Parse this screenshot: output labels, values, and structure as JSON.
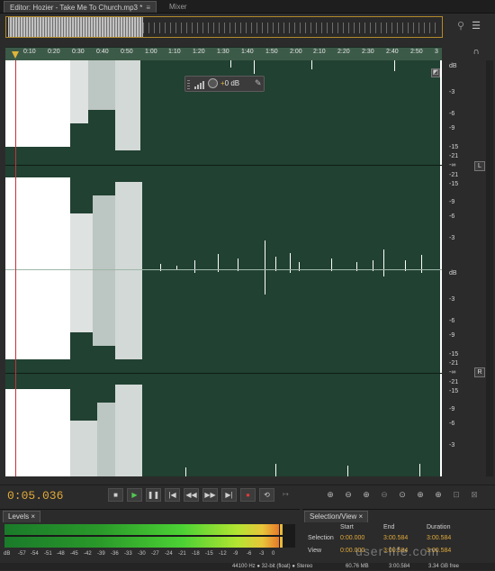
{
  "tabs": {
    "editor": "Editor: Hozier - Take Me To Church.mp3 *",
    "editor_close": "≡",
    "mixer": "Mixer"
  },
  "ruler": {
    "ticks": [
      "0:10",
      "0:20",
      "0:30",
      "0:40",
      "0:50",
      "1:00",
      "1:10",
      "1:20",
      "1:30",
      "1:40",
      "1:50",
      "2:00",
      "2:10",
      "2:20",
      "2:30",
      "2:40",
      "2:50",
      "3"
    ]
  },
  "hud": {
    "volume_prefix": "+",
    "volume_value": "0 dB"
  },
  "db_scale": {
    "top": [
      "dB",
      "-3",
      "-6",
      "-9",
      "-15",
      "-21",
      "-∞",
      "-21",
      "-15",
      "-9",
      "-6",
      "-3"
    ],
    "bottom": [
      "dB",
      "-3",
      "-6",
      "-9",
      "-15",
      "-21",
      "-∞",
      "-21",
      "-15",
      "-9",
      "-6",
      "-3"
    ],
    "left_label": "L",
    "right_label": "R"
  },
  "transport": {
    "timecode": "0:05.036"
  },
  "levels": {
    "tab_label": "Levels",
    "scale": [
      "dB",
      "-57",
      "-54",
      "-51",
      "-48",
      "-45",
      "-42",
      "-39",
      "-36",
      "-33",
      "-30",
      "-27",
      "-24",
      "-21",
      "-18",
      "-15",
      "-12",
      "-9",
      "-6",
      "-3",
      "0"
    ]
  },
  "selection_view": {
    "tab_label": "Selection/View",
    "headers": {
      "start": "Start",
      "end": "End",
      "duration": "Duration"
    },
    "rows": [
      {
        "label": "Selection",
        "start": "0:00.000",
        "end": "3:00.584",
        "duration": "3:00.584"
      },
      {
        "label": "View",
        "start": "0:00.000",
        "end": "3:00.584",
        "duration": "3:00.584"
      }
    ]
  },
  "status_bar": {
    "format": "44100 Hz ● 32-bit (float) ● Stereo",
    "size": "60.76 MB",
    "duration": "3:00.584",
    "free": "3.34 GB free"
  },
  "watermark": "user-life.com"
}
